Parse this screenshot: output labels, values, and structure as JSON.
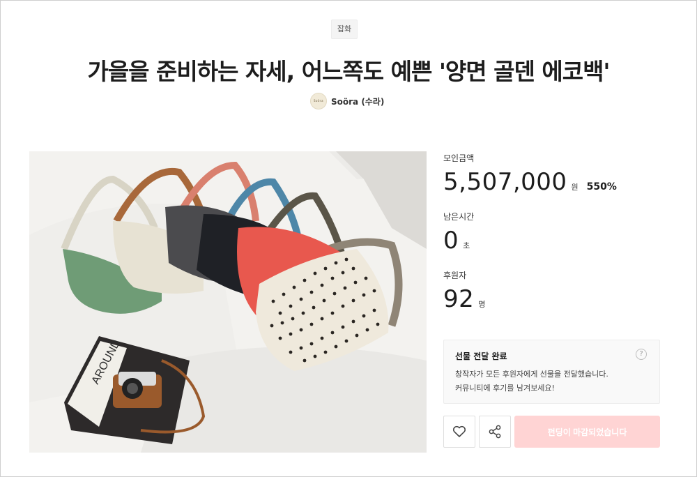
{
  "category": "잡화",
  "project": {
    "title": "가을을 준비하는 자세, 어느쪽도 예쁜 '양면 골덴 에코백'"
  },
  "creator": {
    "avatar_text": "Soöra",
    "name": "Soöra (수라)"
  },
  "stats": {
    "funding": {
      "label": "모인금액",
      "value": "5,507,000",
      "unit": "원",
      "rate": "550%"
    },
    "remaining": {
      "label": "남은시간",
      "value": "0",
      "unit": "초"
    },
    "backers": {
      "label": "후원자",
      "value": "92",
      "unit": "명"
    }
  },
  "notice": {
    "title": "선물 전달 완료",
    "body": "창작자가 모든 후원자에게 선물을 전달했습니다.\n커뮤니티에 후기를 남겨보세요!",
    "help_symbol": "?"
  },
  "actions": {
    "like_icon": "heart-icon",
    "share_icon": "share-icon",
    "fund_label": "펀딩이 마감되었습니다",
    "fund_color": "#ffd4d4"
  },
  "photo": {
    "magazine_text": "AROUND"
  }
}
